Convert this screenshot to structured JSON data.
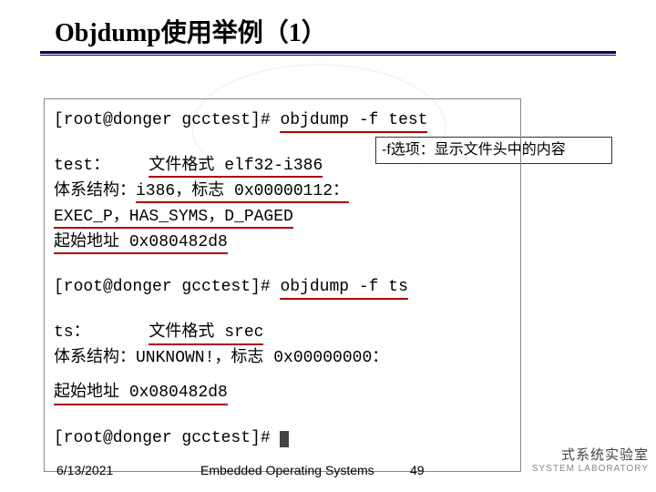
{
  "title": "Objdump使用举例（1）",
  "callout_text": "-f选项：显示文件头中的内容",
  "terminal": {
    "prompt1_prefix": "[root@donger gcctest]# ",
    "cmd1": "objdump -f test",
    "out1a_label": "test：    ",
    "out1a_value": "文件格式 elf32-i386",
    "out1b_prefix": "体系结构：",
    "out1b_arch": "i386，",
    "out1b_flags": "标志 0x00000112：",
    "out1c": "EXEC_P，HAS_SYMS，D_PAGED",
    "out1d_prefix": "起始地址 ",
    "out1d_addr": "0x080482d8",
    "prompt2_prefix": "[root@donger gcctest]# ",
    "cmd2": "objdump -f ts",
    "out2a_label": "ts：      ",
    "out2a_value": "文件格式 srec",
    "out2b_prefix": "体系结构：",
    "out2b_arch": "UNKNOWN!，",
    "out2b_flags": "标志 0x00000000：",
    "out2d_prefix": "起始地址 ",
    "out2d_addr": "0x080482d8",
    "prompt3_prefix": "[root@donger gcctest]# "
  },
  "footer": {
    "date": "6/13/2021",
    "center": "Embedded Operating Systems",
    "page": "49"
  },
  "lab": {
    "cn": "式系统实验室",
    "en": "SYSTEM LABORATORY"
  }
}
